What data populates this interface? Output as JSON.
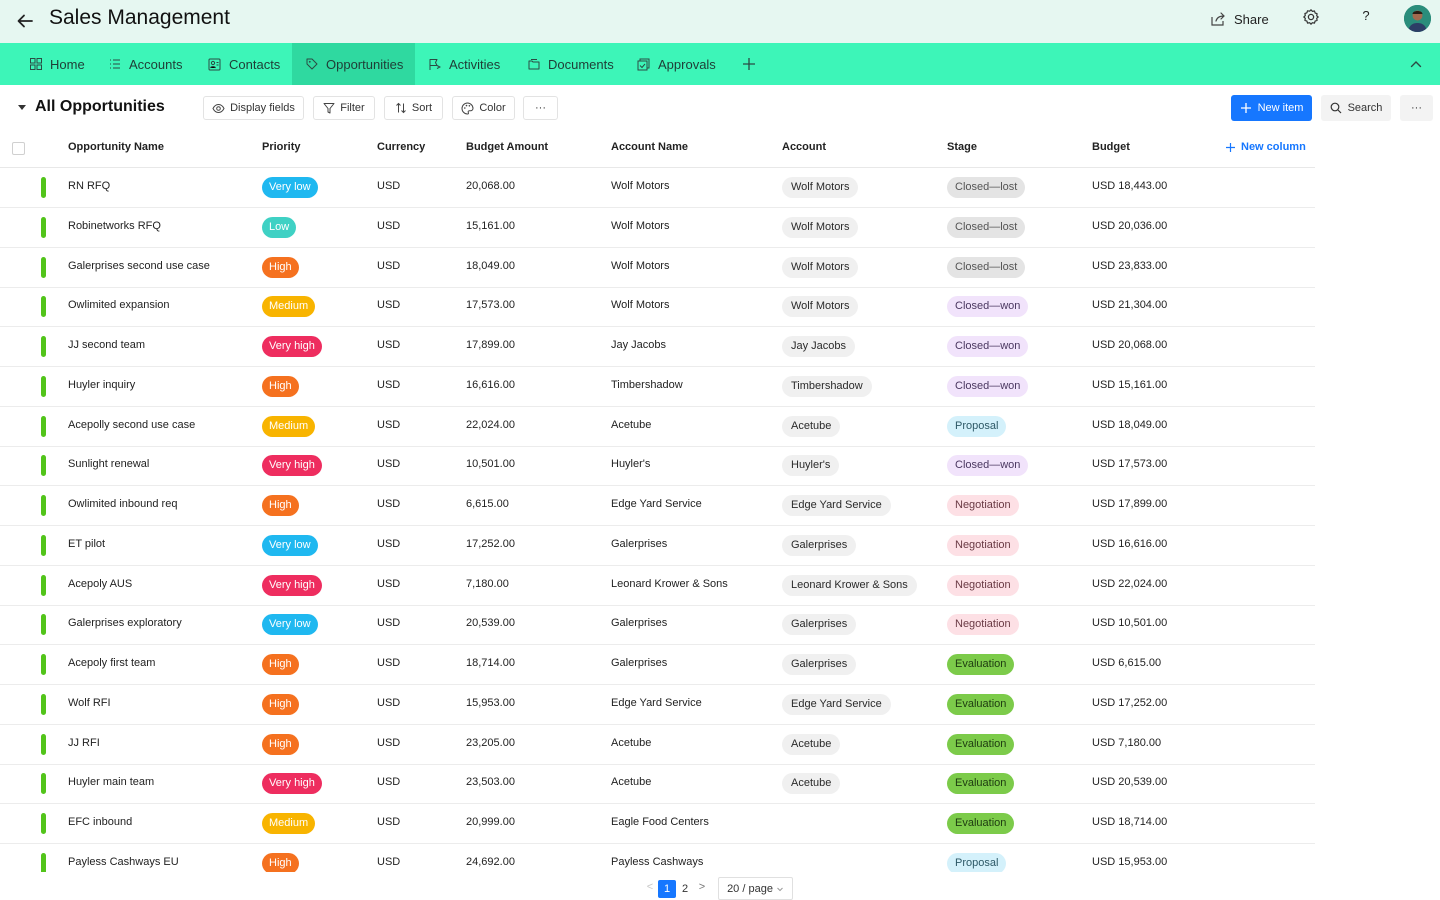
{
  "header": {
    "title": "Sales Management",
    "share_label": "Share",
    "help_label": "?"
  },
  "nav": {
    "tabs": [
      {
        "label": "Home",
        "icon": "grid-icon"
      },
      {
        "label": "Accounts",
        "icon": "list-icon"
      },
      {
        "label": "Contacts",
        "icon": "contact-card-icon"
      },
      {
        "label": "Opportunities",
        "icon": "tag-icon",
        "active": true
      },
      {
        "label": "Activities",
        "icon": "flag-icon"
      },
      {
        "label": "Documents",
        "icon": "folder-icon"
      },
      {
        "label": "Approvals",
        "icon": "approval-icon"
      }
    ]
  },
  "toolbar": {
    "view_title": "All Opportunities",
    "display_fields_label": "Display fields",
    "filter_label": "Filter",
    "sort_label": "Sort",
    "color_label": "Color",
    "more_label": "···",
    "new_item_label": "New item",
    "search_label": "Search",
    "more_right_label": "···"
  },
  "table": {
    "columns": {
      "name": "Opportunity Name",
      "priority": "Priority",
      "currency": "Currency",
      "budget_amount": "Budget Amount",
      "account_name": "Account Name",
      "account": "Account",
      "stage": "Stage",
      "budget": "Budget"
    },
    "new_column_label": "New column",
    "rows": [
      {
        "name": "RN RFQ",
        "priority": "Very low",
        "currency": "USD",
        "budget_amount": "20,068.00",
        "account_name": "Wolf Motors",
        "account": "Wolf Motors",
        "stage": "Closed—lost",
        "budget": "USD 18,443.00"
      },
      {
        "name": "Robinetworks RFQ",
        "priority": "Low",
        "currency": "USD",
        "budget_amount": "15,161.00",
        "account_name": "Wolf Motors",
        "account": "Wolf Motors",
        "stage": "Closed—lost",
        "budget": "USD 20,036.00"
      },
      {
        "name": "Galerprises second use case",
        "priority": "High",
        "currency": "USD",
        "budget_amount": "18,049.00",
        "account_name": "Wolf Motors",
        "account": "Wolf Motors",
        "stage": "Closed—lost",
        "budget": "USD 23,833.00"
      },
      {
        "name": "Owlimited expansion",
        "priority": "Medium",
        "currency": "USD",
        "budget_amount": "17,573.00",
        "account_name": "Wolf Motors",
        "account": "Wolf Motors",
        "stage": "Closed—won",
        "budget": "USD 21,304.00"
      },
      {
        "name": "JJ second team",
        "priority": "Very high",
        "currency": "USD",
        "budget_amount": "17,899.00",
        "account_name": "Jay Jacobs",
        "account": "Jay Jacobs",
        "stage": "Closed—won",
        "budget": "USD 20,068.00"
      },
      {
        "name": "Huyler inquiry",
        "priority": "High",
        "currency": "USD",
        "budget_amount": "16,616.00",
        "account_name": "Timbershadow",
        "account": "Timbershadow",
        "stage": "Closed—won",
        "budget": "USD 15,161.00"
      },
      {
        "name": "Acepolly second use case",
        "priority": "Medium",
        "currency": "USD",
        "budget_amount": "22,024.00",
        "account_name": "Acetube",
        "account": "Acetube",
        "stage": "Proposal",
        "budget": "USD 18,049.00"
      },
      {
        "name": "Sunlight renewal",
        "priority": "Very high",
        "currency": "USD",
        "budget_amount": "10,501.00",
        "account_name": "Huyler's",
        "account": "Huyler's",
        "stage": "Closed—won",
        "budget": "USD 17,573.00"
      },
      {
        "name": "Owlimited inbound req",
        "priority": "High",
        "currency": "USD",
        "budget_amount": "6,615.00",
        "account_name": "Edge Yard Service",
        "account": "Edge Yard Service",
        "stage": "Negotiation",
        "budget": "USD 17,899.00"
      },
      {
        "name": "ET pilot",
        "priority": "Very low",
        "currency": "USD",
        "budget_amount": "17,252.00",
        "account_name": "Galerprises",
        "account": "Galerprises",
        "stage": "Negotiation",
        "budget": "USD 16,616.00"
      },
      {
        "name": "Acepoly AUS",
        "priority": "Very high",
        "currency": "USD",
        "budget_amount": "7,180.00",
        "account_name": "Leonard Krower & Sons",
        "account": "Leonard Krower & Sons",
        "stage": "Negotiation",
        "budget": "USD 22,024.00"
      },
      {
        "name": "Galerprises exploratory",
        "priority": "Very low",
        "currency": "USD",
        "budget_amount": "20,539.00",
        "account_name": "Galerprises",
        "account": "Galerprises",
        "stage": "Negotiation",
        "budget": "USD 10,501.00"
      },
      {
        "name": "Acepoly first team",
        "priority": "High",
        "currency": "USD",
        "budget_amount": "18,714.00",
        "account_name": "Galerprises",
        "account": "Galerprises",
        "stage": "Evaluation",
        "budget": "USD 6,615.00"
      },
      {
        "name": "Wolf RFI",
        "priority": "High",
        "currency": "USD",
        "budget_amount": "15,953.00",
        "account_name": "Edge Yard Service",
        "account": "Edge Yard Service",
        "stage": "Evaluation",
        "budget": "USD 17,252.00"
      },
      {
        "name": "JJ RFI",
        "priority": "High",
        "currency": "USD",
        "budget_amount": "23,205.00",
        "account_name": "Acetube",
        "account": "Acetube",
        "stage": "Evaluation",
        "budget": "USD 7,180.00"
      },
      {
        "name": "Huyler main team",
        "priority": "Very high",
        "currency": "USD",
        "budget_amount": "23,503.00",
        "account_name": "Acetube",
        "account": "Acetube",
        "stage": "Evaluation",
        "budget": "USD 20,539.00"
      },
      {
        "name": "EFC inbound",
        "priority": "Medium",
        "currency": "USD",
        "budget_amount": "20,999.00",
        "account_name": "Eagle Food Centers",
        "account": "",
        "stage": "Evaluation",
        "budget": "USD 18,714.00"
      },
      {
        "name": "Payless Cashways EU",
        "priority": "High",
        "currency": "USD",
        "budget_amount": "24,692.00",
        "account_name": "Payless Cashways",
        "account": "",
        "stage": "Proposal",
        "budget": "USD 15,953.00"
      }
    ]
  },
  "priority_colors": {
    "Very low": {
      "bg": "#1fb8f0",
      "fg": "#ffffff"
    },
    "Low": {
      "bg": "#3fd1c4",
      "fg": "#ffffff"
    },
    "Medium": {
      "bg": "#f8b400",
      "fg": "#ffffff"
    },
    "High": {
      "bg": "#f5711f",
      "fg": "#ffffff"
    },
    "Very high": {
      "bg": "#ee2d5f",
      "fg": "#ffffff"
    }
  },
  "stage_colors": {
    "Closed—lost": {
      "bg": "#e4e4e4",
      "fg": "#555555"
    },
    "Closed—won": {
      "bg": "#f1e3fb",
      "fg": "#4a3760"
    },
    "Proposal": {
      "bg": "#d4f1fb",
      "fg": "#2d5866"
    },
    "Negotiation": {
      "bg": "#fde0e5",
      "fg": "#6a3a44"
    },
    "Evaluation": {
      "bg": "#7ccb4a",
      "fg": "#1d3a10"
    }
  },
  "row_accent_color": "#52c41a",
  "accent_color": "#1677ff",
  "pagination": {
    "prev": "<",
    "pages": [
      "1",
      "2"
    ],
    "current": "1",
    "next": ">",
    "page_size": "20 / page"
  }
}
